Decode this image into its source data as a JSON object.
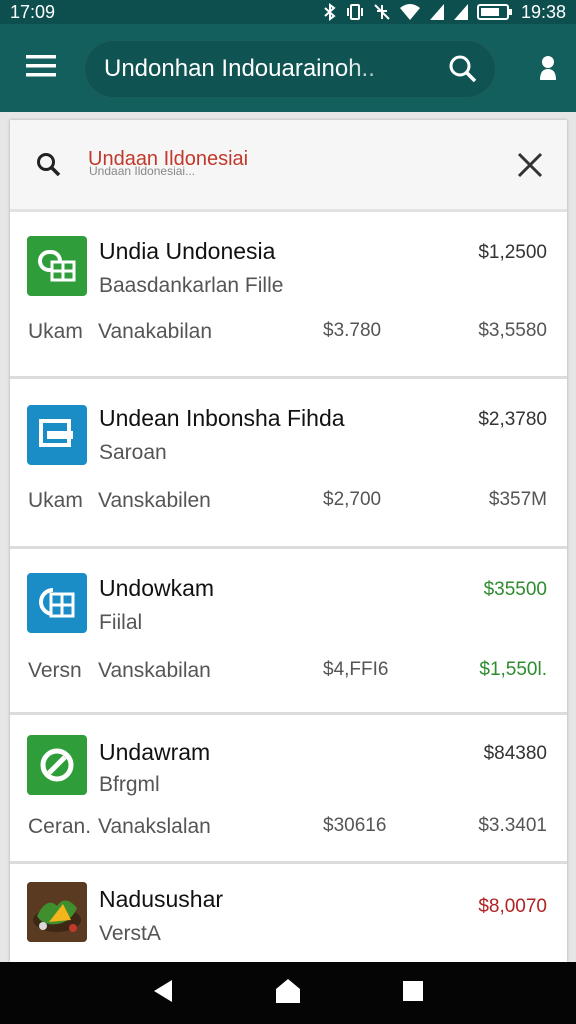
{
  "status": {
    "time_left": "17:09",
    "time_right": "19:38",
    "icons": [
      "bluetooth-icon",
      "vibrate-icon",
      "signal-muted-icon",
      "wifi-icon",
      "signal-icon",
      "signal-icon",
      "battery-icon"
    ]
  },
  "app_bar": {
    "search_text": "Undonhan Indouarainoh..",
    "icons": [
      "menu-icon",
      "search-icon",
      "account-icon"
    ],
    "color": "#135f5e"
  },
  "search_panel": {
    "query": "Undaan Ildonesiai",
    "sub_text": "Undaan Ildonesiai...",
    "icons": [
      "search-icon",
      "close-icon"
    ]
  },
  "items": [
    {
      "title": "Undia Undonesia",
      "subtitle": "Baasdankarlan Fille",
      "price_top": "$1,2500",
      "meta_a": "Ukam",
      "meta_b": "Vanakabilan",
      "meta_c": "$3.780",
      "meta_d": "$3,5580",
      "icon": "spreadsheet-icon",
      "icon_color": "#2e9d3a"
    },
    {
      "title": "Undean Inbonsha Fihda",
      "subtitle": "Saroan",
      "price_top": "$2,3780",
      "meta_a": "Ukam",
      "meta_b": "Vanskabilen",
      "meta_c": "$2,700",
      "meta_d": "$357M",
      "icon": "document-icon",
      "icon_color": "#1a8cc6"
    },
    {
      "title": "Undowkam",
      "subtitle": "Fiilal",
      "price_top": "$35500",
      "meta_a": "Versn",
      "meta_b": "Vanskabilan",
      "meta_c": "$4,FFI6",
      "meta_d": "$1,550l.",
      "icon": "calc-sheet-icon",
      "icon_color": "#1a8cc6",
      "price_top_color": "green",
      "meta_d_color": "green"
    },
    {
      "title": "Undawram",
      "subtitle": "Bfrgml",
      "price_top": "$84380",
      "meta_a": "Ceran.",
      "meta_b": "Vanakslalan",
      "meta_c": "$30616",
      "meta_d": "$3.3401",
      "icon": "block-icon",
      "icon_color": "#2e9d3a"
    },
    {
      "title": "Nadusushar",
      "subtitle": "VerstA",
      "price_top": "$8,0070",
      "icon": "food-photo-icon",
      "icon_color": "#6b4a2c",
      "price_top_color": "red"
    }
  ],
  "nav": {
    "icons": [
      "back-icon",
      "home-icon",
      "recents-icon"
    ]
  }
}
